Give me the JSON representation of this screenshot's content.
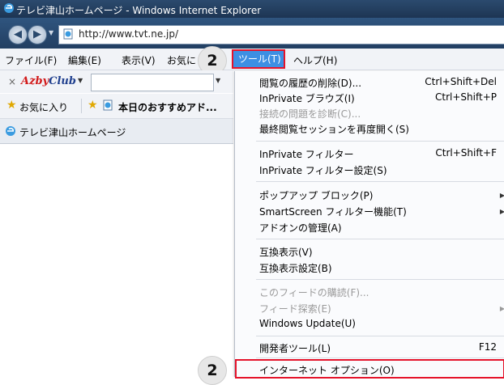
{
  "window": {
    "title": "テレビ津山ホームページ - Windows Internet Explorer",
    "icon": "ie-icon"
  },
  "address": {
    "url": "http://www.tvt.ne.jp/",
    "icon": "page-icon"
  },
  "menubar": {
    "items": [
      "ファイル(F)",
      "編集(E)",
      "表示(V)",
      "お気に"
    ],
    "tools": "ツール(T)",
    "help": "ヘルプ(H)"
  },
  "callouts": {
    "top": "2",
    "bottom": "2"
  },
  "azby": {
    "close": "×",
    "logo_main": "Azby",
    "logo_sub": "Club",
    "input_value": ""
  },
  "favorites": {
    "label": "お気に入り",
    "link": "本日のおすすめアド..."
  },
  "tab": {
    "label": "テレビ津山ホームページ"
  },
  "tools_menu": {
    "items": [
      {
        "label": "閲覧の履歴の削除(D)...",
        "shortcut": "Ctrl+Shift+Del",
        "disabled": false
      },
      {
        "label": "InPrivate ブラウズ(I)",
        "shortcut": "Ctrl+Shift+P",
        "disabled": false
      },
      {
        "label": "接続の問題を診断(C)...",
        "shortcut": "",
        "disabled": true
      },
      {
        "label": "最終閲覧セッションを再度開く(S)",
        "shortcut": "",
        "disabled": false
      },
      {
        "label": "InPrivate フィルター",
        "shortcut": "Ctrl+Shift+F",
        "disabled": false
      },
      {
        "label": "InPrivate フィルター設定(S)",
        "shortcut": "",
        "disabled": false
      },
      {
        "label": "ポップアップ ブロック(P)",
        "shortcut": "",
        "disabled": false,
        "submenu": true
      },
      {
        "label": "SmartScreen フィルター機能(T)",
        "shortcut": "",
        "disabled": false,
        "submenu": true
      },
      {
        "label": "アドオンの管理(A)",
        "shortcut": "",
        "disabled": false
      },
      {
        "label": "互換表示(V)",
        "shortcut": "",
        "disabled": false
      },
      {
        "label": "互換表示設定(B)",
        "shortcut": "",
        "disabled": false
      },
      {
        "label": "このフィードの購読(F)...",
        "shortcut": "",
        "disabled": true
      },
      {
        "label": "フィード探索(E)",
        "shortcut": "",
        "disabled": true,
        "submenu": true
      },
      {
        "label": "Windows Update(U)",
        "shortcut": "",
        "disabled": false
      },
      {
        "label": "開発者ツール(L)",
        "shortcut": "F12",
        "disabled": false
      },
      {
        "label": "インターネット オプション(O)",
        "shortcut": "",
        "disabled": false,
        "highlighted": true
      }
    ]
  },
  "colors": {
    "highlight_border": "#e5132a",
    "menu_selected": "#3d8fe3",
    "title_bg": "#1d3553"
  }
}
